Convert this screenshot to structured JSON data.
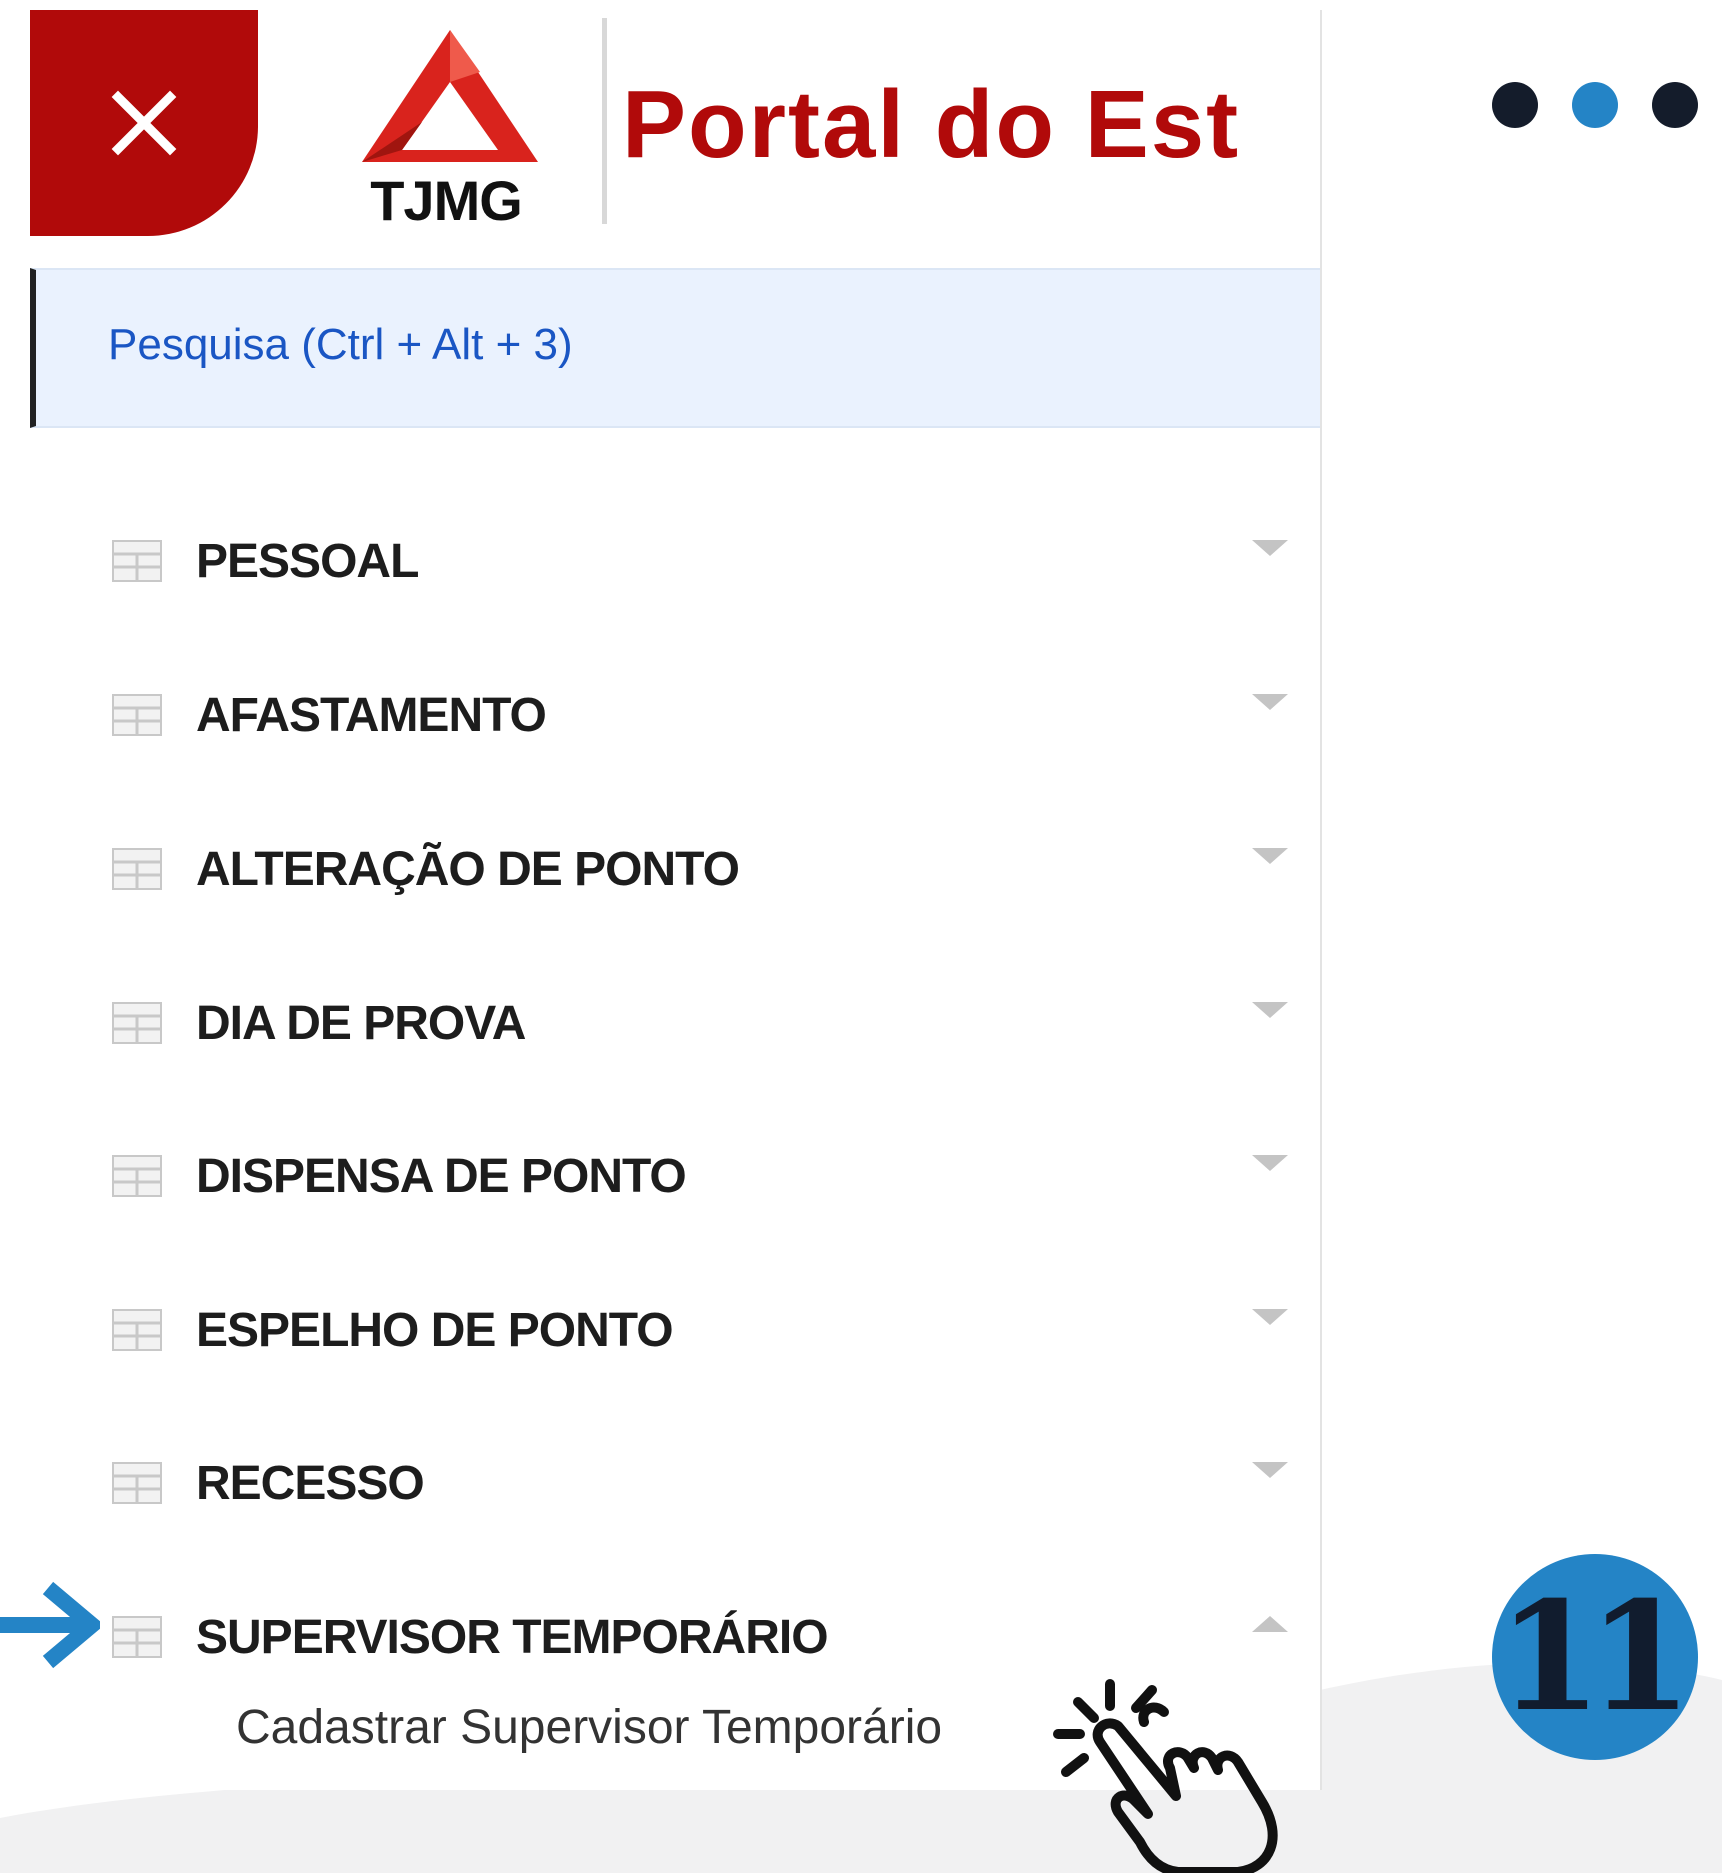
{
  "header": {
    "close_icon": "close-icon",
    "logo_text": "TJMG",
    "title": "Portal do Est"
  },
  "search": {
    "label": "Pesquisa (Ctrl + Alt + 3)"
  },
  "menu": {
    "items": [
      {
        "label": "PESSOAL",
        "expanded": false
      },
      {
        "label": "AFASTAMENTO",
        "expanded": false
      },
      {
        "label": "ALTERAÇÃO DE PONTO",
        "expanded": false
      },
      {
        "label": "DIA DE PROVA",
        "expanded": false
      },
      {
        "label": "DISPENSA DE PONTO",
        "expanded": false
      },
      {
        "label": "ESPELHO DE PONTO",
        "expanded": false
      },
      {
        "label": "RECESSO",
        "expanded": false
      },
      {
        "label": "SUPERVISOR TEMPORÁRIO",
        "expanded": true
      }
    ],
    "sub_item": "Cadastrar Supervisor Temporário"
  },
  "overlay": {
    "step_number": "11",
    "dots_colors": [
      "#141c2b",
      "#2484c6",
      "#141c2b"
    ],
    "accent_color": "#2484c6",
    "brand_color": "#b10a0a"
  }
}
